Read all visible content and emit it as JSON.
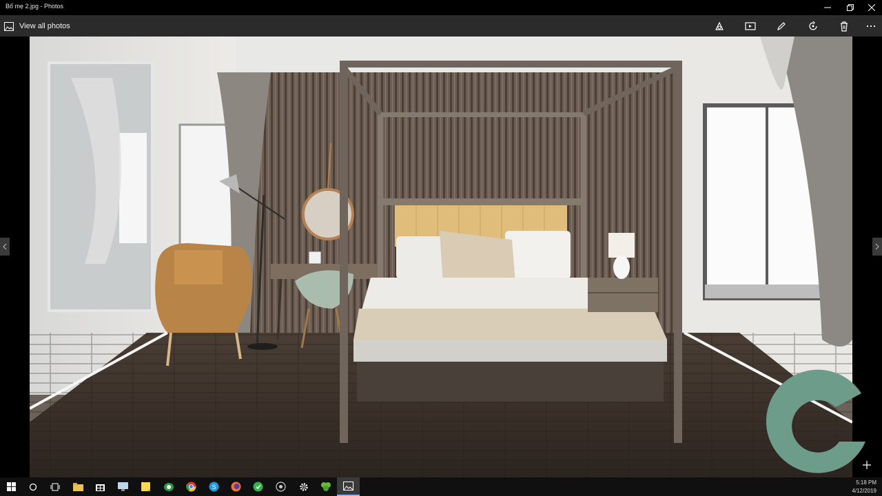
{
  "window": {
    "title": "Bố mẹ 2.jpg - Photos"
  },
  "toolbar": {
    "view_all_label": "View all photos",
    "actions": [
      {
        "icon": "enhance-icon"
      },
      {
        "icon": "slideshow-icon"
      },
      {
        "icon": "edit-icon"
      },
      {
        "icon": "rotate-icon"
      },
      {
        "icon": "delete-icon"
      },
      {
        "icon": "more-icon"
      }
    ]
  },
  "watermark": {
    "text": "CEOTIC ST",
    "color": "#6e9c8b"
  },
  "taskbar": {
    "apps": [
      {
        "icon": "start-icon"
      },
      {
        "icon": "cortana-icon"
      },
      {
        "icon": "task-view-icon"
      },
      {
        "icon": "file-explorer-icon"
      },
      {
        "icon": "store-icon"
      },
      {
        "icon": "monitor-app-icon"
      },
      {
        "icon": "sticky-notes-icon"
      },
      {
        "icon": "coccoc-icon"
      },
      {
        "icon": "chrome-icon"
      },
      {
        "icon": "skype-icon"
      },
      {
        "icon": "firefox-icon"
      },
      {
        "icon": "green-app-icon"
      },
      {
        "icon": "camera-app-icon"
      },
      {
        "icon": "settings-icon"
      },
      {
        "icon": "clover-icon"
      },
      {
        "icon": "photos-icon"
      }
    ],
    "clock_time": "5:18 PM",
    "clock_date": "4/12/2019"
  },
  "colors": {
    "titlebar": "#000000",
    "toolbar": "#2b2b2b",
    "taskbar": "#101010",
    "accent": "#8ab4ff"
  }
}
